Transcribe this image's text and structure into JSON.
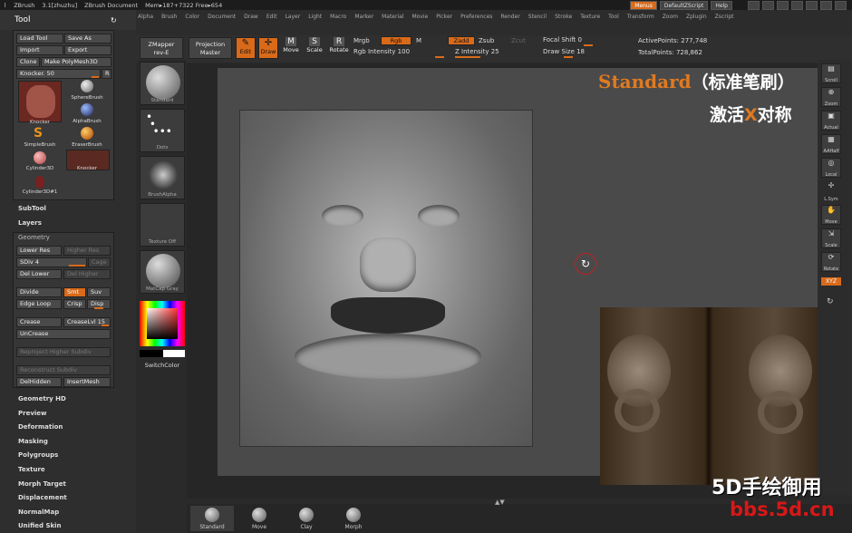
{
  "title_bar": {
    "app": "ZBrush",
    "version": "3.1[zhuzhu]",
    "document": "ZBrush Document",
    "mem": "Mem▸187+7322 Free▸654"
  },
  "top_right": {
    "menus": "Menus",
    "script": "DefaultZScript",
    "help": "Help"
  },
  "menu_items": [
    "Alpha",
    "Brush",
    "Color",
    "Document",
    "Draw",
    "Edit",
    "Layer",
    "Light",
    "Macro",
    "Marker",
    "Material",
    "Movie",
    "Picker",
    "Preferences",
    "Render",
    "Stencil",
    "Stroke",
    "Texture",
    "Tool",
    "Transform",
    "Zoom",
    "Zplugin",
    "Zscript"
  ],
  "tool_panel": {
    "title": "Tool",
    "load_tool": "Load Tool",
    "save_as": "Save As",
    "import": "Import",
    "export": "Export",
    "clone": "Clone",
    "make_polymesh": "Make PolyMesh3D",
    "knocker_slider": "Knocker. 50",
    "r_button": "R",
    "tools": [
      {
        "label": "Knocker"
      },
      {
        "label": "SphereBrush"
      },
      {
        "label": "AlphaBrush"
      },
      {
        "label": "SimpleBrush"
      },
      {
        "label": "EraserBrush"
      },
      {
        "label": "Cylinder3D"
      },
      {
        "label": "Knocker"
      },
      {
        "label": "Cylinder3D#1"
      }
    ],
    "subtool": "SubTool",
    "layers": "Layers",
    "geometry": "Geometry",
    "lower_res": "Lower Res",
    "higher_res": "Higher Res",
    "sdiv": "SDiv 4",
    "cage": "Cage",
    "del_lower": "Del Lower",
    "del_higher": "Del Higher",
    "divide": "Divide",
    "smt": "Smt",
    "suv": "Suv",
    "edge_loop": "Edge Loop",
    "crisp": "Crisp",
    "disp": "Disp",
    "crease": "Crease",
    "crease_lvl": "CreaseLvl 15",
    "uncrease": "UnCrease",
    "reproject": "Reproject Higher Subdiv",
    "reconstruct": "Reconstruct Subdiv",
    "delhidden": "DelHidden",
    "insertmesh": "InsertMesh",
    "sections": [
      "Geometry HD",
      "Preview",
      "Deformation",
      "Masking",
      "Polygroups",
      "Texture",
      "Morph Target",
      "Displacement",
      "NormalMap",
      "Unified Skin"
    ]
  },
  "controls": {
    "zmapper": "ZMapper",
    "zmapper_rev": "rev-E",
    "projection": "Projection",
    "projection_master": "Master",
    "edit": "Edit",
    "draw": "Draw",
    "move": "Move",
    "scale": "Scale",
    "rotate": "Rotate",
    "mrgb": "Mrgb",
    "rgb": "Rgb",
    "m": "M",
    "rgb_intensity": "Rgb Intensity 100",
    "zadd": "Zadd",
    "zsub": "Zsub",
    "zcut": "Zcut",
    "z_intensity": "Z Intensity 25",
    "focal_shift": "Focal Shift 0",
    "draw_size": "Draw Size 18",
    "active_points": "ActivePoints: 277,748",
    "total_points": "TotalPoints: 728,862"
  },
  "left_tray": [
    {
      "label": "Standard"
    },
    {
      "label": "Dots"
    },
    {
      "label": "BrushAlpha"
    },
    {
      "label": "Texture Off"
    },
    {
      "label": "MatCap Gray"
    }
  ],
  "switch_color": "SwitchColor",
  "right_tray": [
    {
      "label": "Scroll"
    },
    {
      "label": "Zoom"
    },
    {
      "label": "Actual"
    },
    {
      "label": "AAHalf"
    },
    {
      "label": "Local"
    },
    {
      "label": "L.Sym"
    },
    {
      "label": "Move"
    },
    {
      "label": "Scale"
    },
    {
      "label": "Rotate"
    }
  ],
  "xyz": "XYZ",
  "bottom_brushes": [
    {
      "label": "Standard"
    },
    {
      "label": "Move"
    },
    {
      "label": "Clay"
    },
    {
      "label": "Morph"
    }
  ],
  "overlay": {
    "brush_name": "Standard",
    "brush_cn": "（标准笔刷）",
    "line2a": "激活",
    "line2x": "X",
    "line2b": "对称",
    "watermark": "5D手绘御用",
    "site": "bbs.5d.cn"
  }
}
